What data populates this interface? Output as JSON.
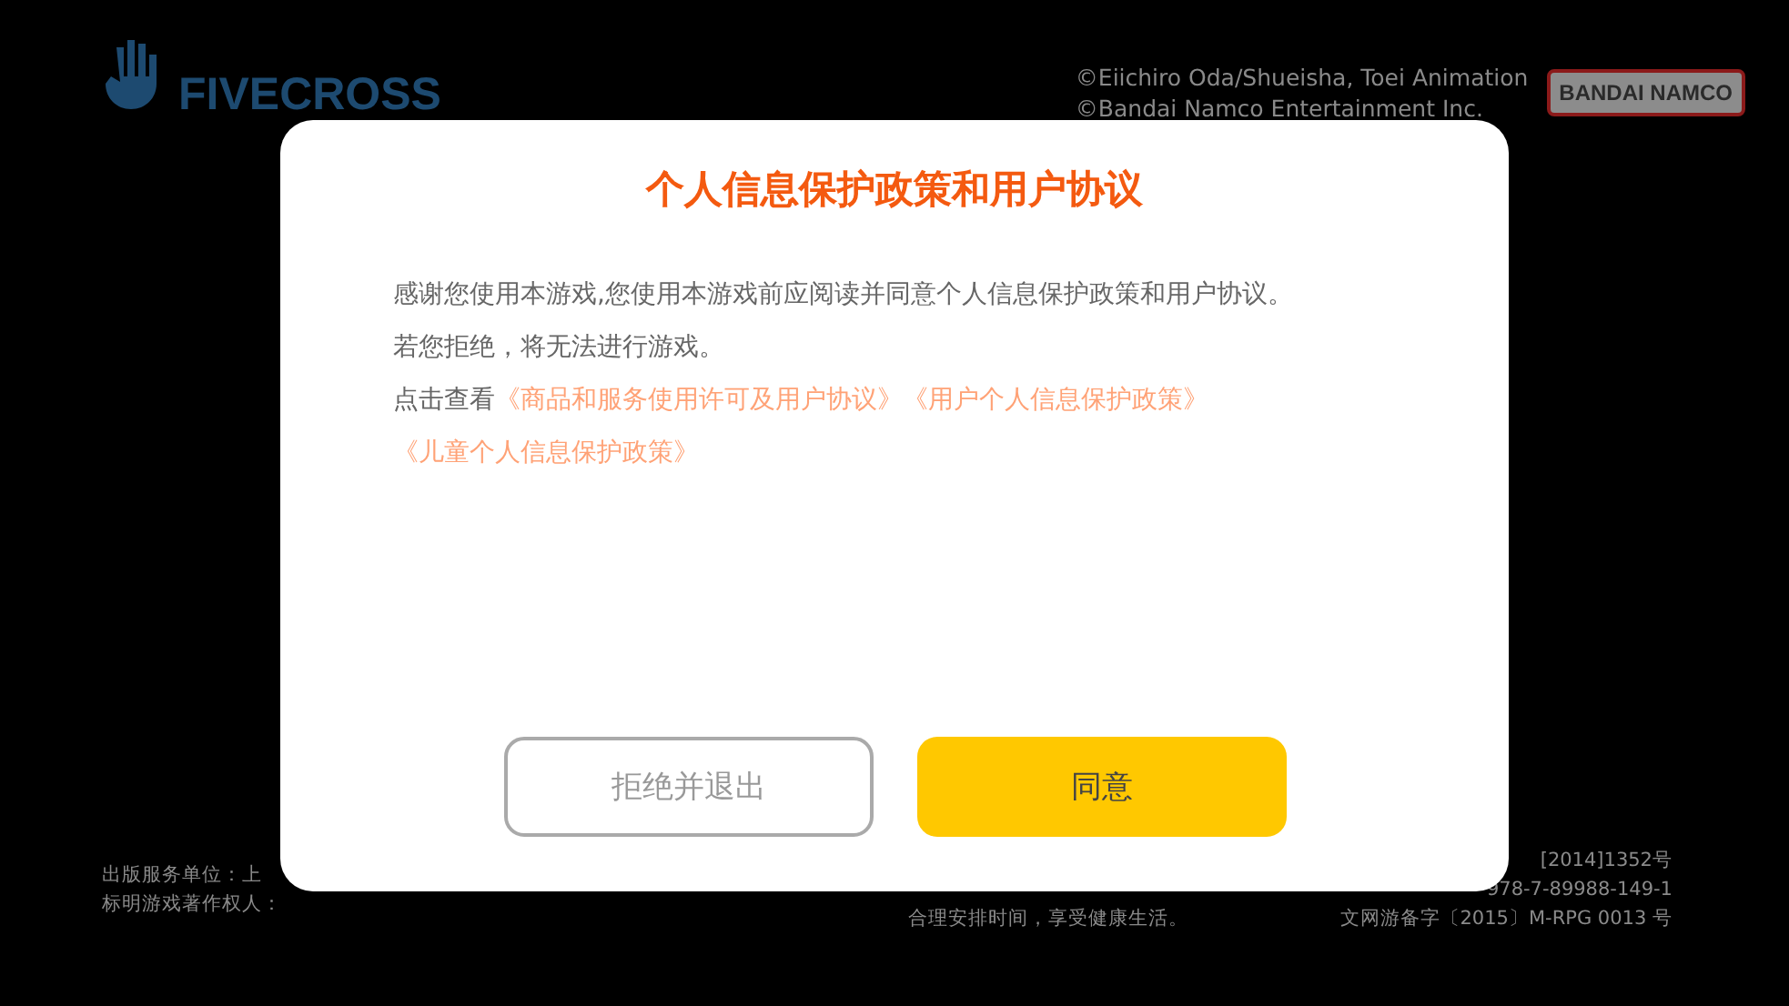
{
  "backdrop": {
    "logo_text": "FIVECROSS",
    "copyright_lines": [
      "©Eiichiro Oda/Shueisha, Toei Animation",
      "©Bandai Namco Entertainment Inc."
    ],
    "publisher_logo": "BANDAI NAMCO",
    "footer_left": [
      "出版服务单位：上",
      "标明游戏著作权人："
    ],
    "footer_center": [
      "合理安排时间，享受健康生活。"
    ],
    "footer_right": [
      "[2014]1352号",
      "978-7-89988-149-1",
      "文网游备字〔2015〕M-RPG 0013 号"
    ]
  },
  "dialog": {
    "title": "个人信息保护政策和用户协议",
    "lines": [
      "感谢您使用本游戏,您使用本游戏前应阅读并同意个人信息保护政策和用户协议。",
      "若您拒绝，将无法进行游戏。"
    ],
    "links_prefix": "点击查看",
    "links": [
      "《商品和服务使用许可及用户协议》",
      "《用户个人信息保护政策》",
      "《儿童个人信息保护政策》"
    ],
    "buttons": [
      {
        "label": "拒绝并退出",
        "kind": "secondary"
      },
      {
        "label": "同意",
        "kind": "primary"
      }
    ]
  }
}
